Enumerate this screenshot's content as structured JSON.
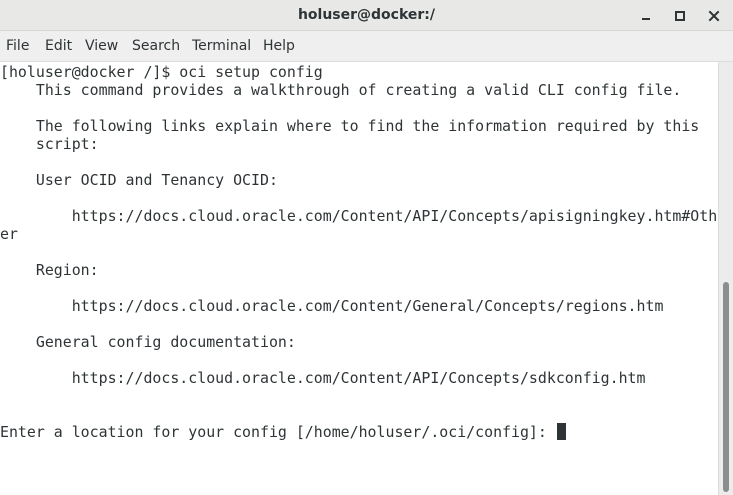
{
  "window": {
    "title": "holuser@docker:/",
    "controls": [
      "minimize-icon",
      "maximize-icon",
      "close-icon"
    ]
  },
  "menu": {
    "file": "File",
    "edit": "Edit",
    "view": "View",
    "search": "Search",
    "terminal": "Terminal",
    "help": "Help"
  },
  "terminal": {
    "lines": {
      "l0": "[holuser@docker /]$ oci setup config",
      "l1": "    This command provides a walkthrough of creating a valid CLI config file.",
      "l2": "",
      "l3": "    The following links explain where to find the information required by this",
      "l4": "    script:",
      "l5": "",
      "l6": "    User OCID and Tenancy OCID:",
      "l7": "",
      "l8": "        https://docs.cloud.oracle.com/Content/API/Concepts/apisigningkey.htm#Oth",
      "l9": "er",
      "l10": "",
      "l11": "    Region:",
      "l12": "",
      "l13": "        https://docs.cloud.oracle.com/Content/General/Concepts/regions.htm",
      "l14": "",
      "l15": "    General config documentation:",
      "l16": "",
      "l17": "        https://docs.cloud.oracle.com/Content/API/Concepts/sdkconfig.htm",
      "l18": "",
      "l19": "",
      "l20": "Enter a location for your config [/home/holuser/.oci/config]: "
    }
  },
  "colors": {
    "titlebar_bg": "#e8e8e7",
    "menubar_bg": "#efefef",
    "text": "#2e3436",
    "terminal_bg": "#ffffff",
    "scroll_thumb": "#8b8e8f"
  }
}
